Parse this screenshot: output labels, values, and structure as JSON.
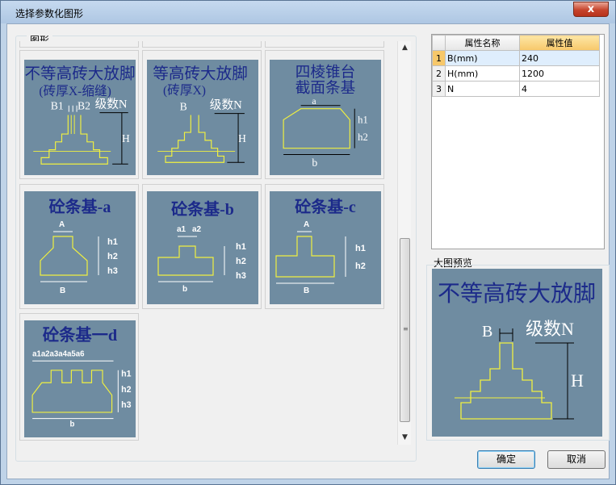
{
  "window": {
    "title": "选择参数化图形",
    "close_glyph": "x"
  },
  "group_label": "图形",
  "thumbnails": [
    {
      "id": "t1",
      "lines": [
        "不等高砖大放脚",
        "(砖厚X-缩缝)"
      ],
      "labels": [
        "B1",
        "B2",
        "级数N",
        "H"
      ]
    },
    {
      "id": "t2",
      "lines": [
        "等高砖大放脚",
        "(砖厚X)"
      ],
      "labels": [
        "B",
        "级数N",
        "H"
      ]
    },
    {
      "id": "t3",
      "lines": [
        "四棱锥台",
        "截面条基"
      ],
      "labels": [
        "a",
        "h1",
        "h2",
        "b"
      ]
    },
    {
      "id": "t4",
      "lines": [
        "砼条基-a"
      ],
      "labels": [
        "A",
        "h1",
        "h2",
        "h3",
        "B"
      ]
    },
    {
      "id": "t5",
      "lines": [
        "砼条基-b"
      ],
      "labels": [
        "a1",
        "a2",
        "h1",
        "h2",
        "h3",
        "b"
      ]
    },
    {
      "id": "t6",
      "lines": [
        "砼条基-c"
      ],
      "labels": [
        "A",
        "h1",
        "h2",
        "B"
      ]
    },
    {
      "id": "t7",
      "lines": [
        "砼条基一d"
      ],
      "labels": [
        "a1a2a3a4a5a6",
        "h1",
        "h2",
        "h3",
        "b"
      ]
    }
  ],
  "properties": {
    "col_name": "属性名称",
    "col_value": "属性值",
    "rows": [
      {
        "num": "1",
        "name": "B(mm)",
        "value": "240"
      },
      {
        "num": "2",
        "name": "H(mm)",
        "value": "1200"
      },
      {
        "num": "3",
        "name": "N",
        "value": "4"
      }
    ]
  },
  "preview": {
    "label": "大图预览",
    "title": "不等高砖大放脚",
    "labels": [
      "B",
      "级数N",
      "H"
    ]
  },
  "buttons": {
    "ok": "确定",
    "cancel": "取消"
  },
  "colors": {
    "thumb_bg": "#6f8ca1",
    "title_text": "#1c2a8a",
    "line": "#f0f040"
  }
}
